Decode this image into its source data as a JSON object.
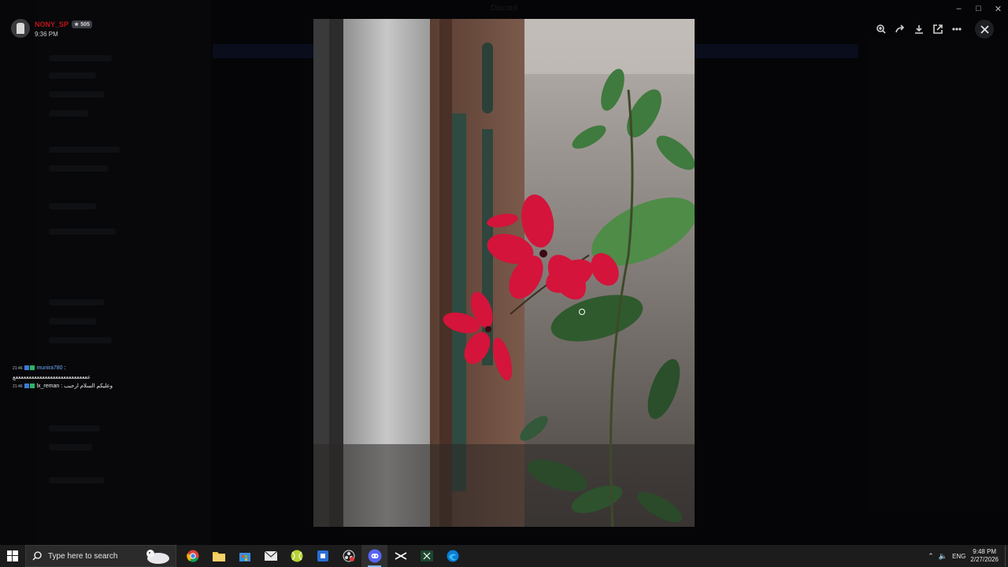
{
  "window": {
    "title": "Discord"
  },
  "overlay": {
    "username": "NONY_SP",
    "badge": "505",
    "time": "9:36 PM"
  },
  "chat": {
    "messages": [
      {
        "ts": "21:46",
        "author": "munira780",
        "sep": ":",
        "text": "ععععععععععععععععععععععععععععع"
      },
      {
        "ts": "21:46",
        "author": "lx_reman",
        "sep": ":",
        "text": "وعليكم السلام ارحبب"
      }
    ]
  },
  "viewer": {
    "toolbar": [
      "zoom-in-icon",
      "forward-icon",
      "download-icon",
      "open-external-icon",
      "more-icon"
    ],
    "close_label": "Close"
  },
  "taskbar": {
    "search_placeholder": "Type here to search",
    "apps": [
      "chrome",
      "file-explorer",
      "microsoft-store",
      "mail",
      "tennis-ball-app",
      "blue-app",
      "obs",
      "discord",
      "capcut",
      "excel",
      "edge"
    ],
    "active_app": "discord",
    "language": "ENG",
    "time": "9:48 PM",
    "date": "2/27/2026"
  },
  "colors": {
    "username": "#c0141a",
    "chat_author": "#6da8ff",
    "flower": "#d4143a",
    "taskbar": "#1c1c1c"
  }
}
